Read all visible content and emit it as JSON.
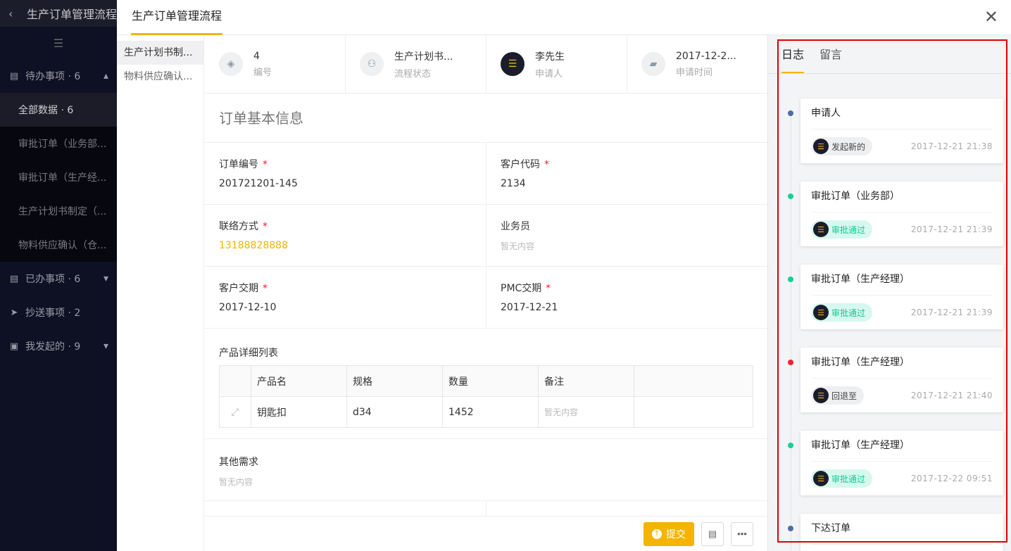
{
  "sidebar": {
    "app_title": "生产订单管理流程",
    "groups": [
      {
        "label": "待办事项 · 6",
        "icon": "todo-icon",
        "chevron": "▴"
      },
      {
        "label": "已办事项 · 6",
        "icon": "done-icon",
        "chevron": "▾"
      },
      {
        "label": "抄送事项 · 2",
        "icon": "send-icon",
        "chevron": ""
      },
      {
        "label": "我发起的 · 9",
        "icon": "mine-icon",
        "chevron": "▾"
      }
    ],
    "sub_items": [
      "全部数据 · 6",
      "审批订单（业务部...",
      "审批订单（生产经...",
      "生产计划书制定（...",
      "物料供应确认（仓..."
    ]
  },
  "header": {
    "tab": "生产订单管理流程",
    "close": "✕"
  },
  "steps": [
    "生产计划书制...",
    "物料供应确认..."
  ],
  "summary": [
    {
      "value": "4",
      "key": "编号"
    },
    {
      "value": "生产计划书...",
      "key": "流程状态"
    },
    {
      "value": "李先生",
      "key": "申请人"
    },
    {
      "value": "2017-12-2...",
      "key": "申请时间"
    }
  ],
  "section_title": "订单基本信息",
  "fields": [
    {
      "label": "订单编号",
      "required": "*",
      "value": "201721201-145"
    },
    {
      "label": "客户代码",
      "required": "*",
      "value": "2134"
    },
    {
      "label": "联络方式",
      "required": "*",
      "value": "13188828888"
    },
    {
      "label": "业务员",
      "required": "",
      "value": "暂无内容"
    },
    {
      "label": "客户交期",
      "required": "*",
      "value": " 2017-12-10"
    },
    {
      "label": "PMC交期",
      "required": "*",
      "value": " 2017-12-21"
    }
  ],
  "products": {
    "label": "产品详细列表",
    "columns": [
      "产品名",
      "规格",
      "数量",
      "备注"
    ],
    "rows": [
      [
        "钥匙扣",
        "d34",
        "1452",
        "暂无内容"
      ]
    ]
  },
  "other": {
    "label": "其他需求",
    "value": "暂无内容"
  },
  "footer": {
    "submit": "提交"
  },
  "right": {
    "tabs": [
      "日志",
      "留言"
    ],
    "log": [
      {
        "title": "申请人",
        "tag": "发起新的",
        "tag_style": "gray",
        "dot": "#4a6fa5",
        "time": "2017-12-21 21:38"
      },
      {
        "title": "审批订单（业务部）",
        "tag": "审批通过",
        "tag_style": "green",
        "dot": "#12d197",
        "time": "2017-12-21 21:39"
      },
      {
        "title": "审批订单（生产经理）",
        "tag": "审批通过",
        "tag_style": "green",
        "dot": "#12d197",
        "time": "2017-12-21 21:39"
      },
      {
        "title": "审批订单（生产经理）",
        "tag": "回退至",
        "tag_style": "gray",
        "dot": "#f5222d",
        "time": "2017-12-21 21:40"
      },
      {
        "title": "审批订单（生产经理）",
        "tag": "审批通过",
        "tag_style": "green",
        "dot": "#12d197",
        "time": "2017-12-22 09:51"
      },
      {
        "title": "下达订单",
        "tag": "",
        "tag_style": "gray",
        "dot": "#4a6fa5",
        "time": ""
      }
    ]
  }
}
